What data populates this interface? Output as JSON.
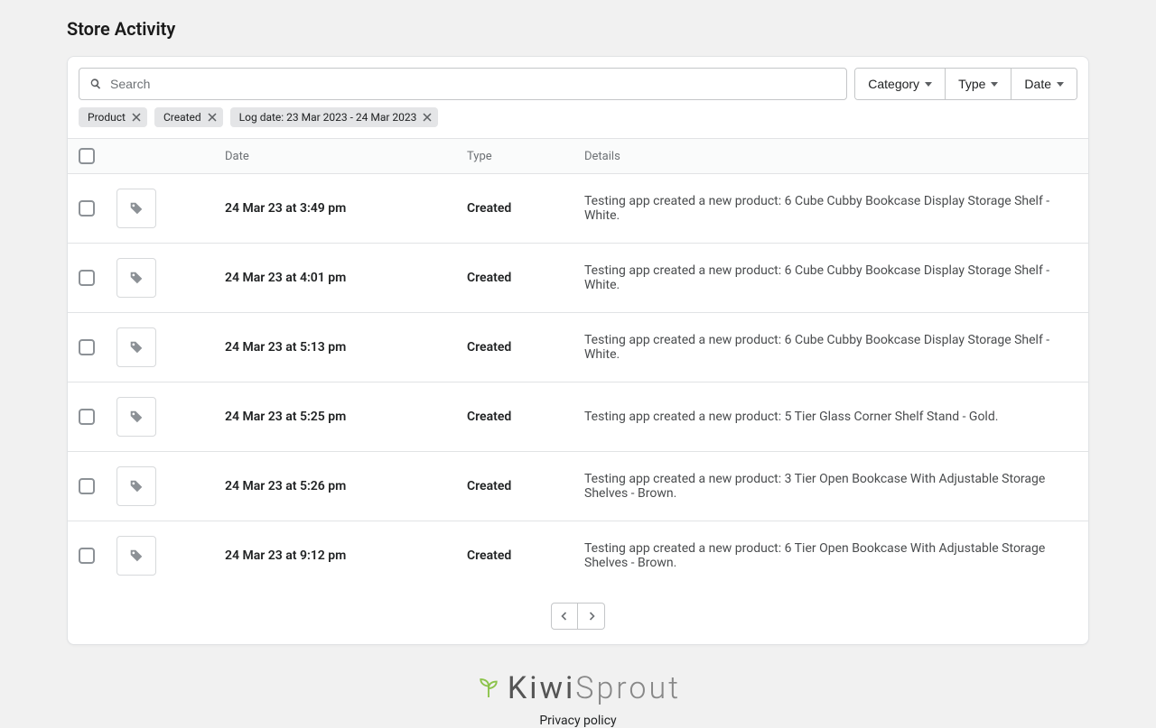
{
  "page": {
    "title": "Store Activity"
  },
  "search": {
    "placeholder": "Search"
  },
  "filters": {
    "category_label": "Category",
    "type_label": "Type",
    "date_label": "Date"
  },
  "chips": [
    {
      "label": "Product"
    },
    {
      "label": "Created"
    },
    {
      "label": "Log date: 23 Mar 2023 - 24 Mar 2023"
    }
  ],
  "columns": {
    "date": "Date",
    "type": "Type",
    "details": "Details"
  },
  "rows": [
    {
      "date": "24 Mar 23 at 3:49 pm",
      "type": "Created",
      "details": "Testing app created a new product: 6 Cube Cubby Bookcase Display Storage Shelf - White."
    },
    {
      "date": "24 Mar 23 at 4:01 pm",
      "type": "Created",
      "details": "Testing app created a new product: 6 Cube Cubby Bookcase Display Storage Shelf - White."
    },
    {
      "date": "24 Mar 23 at 5:13 pm",
      "type": "Created",
      "details": "Testing app created a new product: 6 Cube Cubby Bookcase Display Storage Shelf - White."
    },
    {
      "date": "24 Mar 23 at 5:25 pm",
      "type": "Created",
      "details": "Testing app created a new product: 5 Tier Glass Corner Shelf Stand - Gold."
    },
    {
      "date": "24 Mar 23 at 5:26 pm",
      "type": "Created",
      "details": "Testing app created a new product: 3 Tier Open Bookcase With Adjustable Storage Shelves - Brown."
    },
    {
      "date": "24 Mar 23 at 9:12 pm",
      "type": "Created",
      "details": "Testing app created a new product: 6 Tier Open Bookcase With Adjustable Storage Shelves - Brown."
    }
  ],
  "footer": {
    "brand_a": "Kiwi",
    "brand_b": "Sprout",
    "privacy": "Privacy policy"
  }
}
